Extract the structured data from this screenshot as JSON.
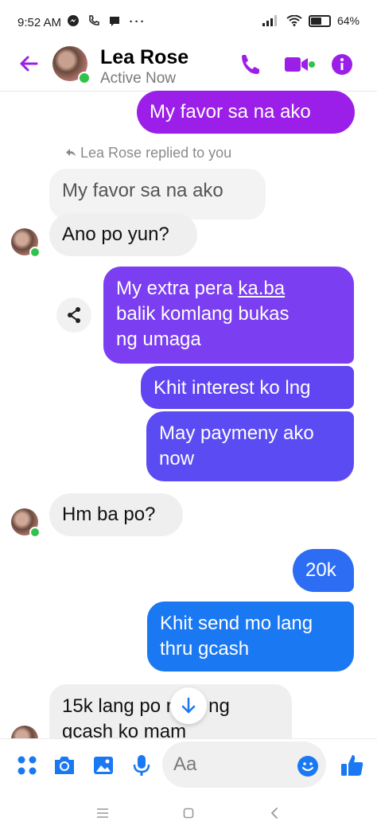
{
  "status_bar": {
    "time": "9:52 AM",
    "battery": "64%",
    "battery_level": 0.64
  },
  "header": {
    "contact_name": "Lea Rose",
    "contact_status": "Active Now"
  },
  "messages": {
    "m1": "My favor sa na ako",
    "reply_note": "Lea Rose replied to you",
    "m2_quoted": "My favor sa na ako",
    "m3": "Ano po yun?",
    "m4_l1_pre": "My extra pera ",
    "m4_l1_link": "ka.ba",
    "m4_l2": "balik komlang bukas",
    "m4_l3": "ng umaga",
    "m5": "Khit interest ko lng",
    "m6_l1": "May paymeny ako",
    "m6_l2": "now",
    "m7": "Hm ba po?",
    "m8": "20k",
    "m9_l1": "Khit send mo lang",
    "m9_l2": "thru gcash",
    "m10_l1": "15k lang po man ng",
    "m10_l2": "gcash ko mam"
  },
  "composer": {
    "placeholder": "Aa"
  },
  "colors": {
    "accent_purple": "#9b1fe8",
    "blue": "#1a78f2",
    "online": "#31c24d",
    "incoming_bg": "#efefef"
  }
}
